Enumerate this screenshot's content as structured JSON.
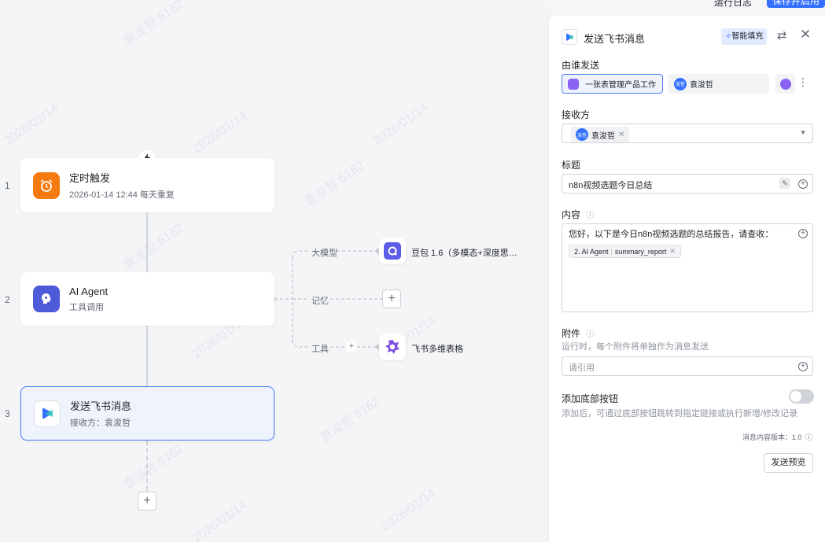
{
  "topbar": {
    "run_log": "运行日志",
    "save_publish": "保存并启用"
  },
  "watermark": {
    "text": "袁浚哲 6162",
    "date": "2026/01/14"
  },
  "flow": {
    "nodes": [
      {
        "num": "1",
        "title": "定时触发",
        "subtitle": "2026-01-14 12:44 每天重复"
      },
      {
        "num": "2",
        "title": "AI Agent",
        "subtitle": "工具调用"
      },
      {
        "num": "3",
        "title": "发送飞书消息",
        "subtitle": "接收方：袁浚哲"
      }
    ],
    "branches": [
      {
        "label": "大模型",
        "tool": "豆包 1.6（多模态+深度思…"
      },
      {
        "label": "记忆",
        "tool": ""
      },
      {
        "label": "工具",
        "tool": "飞书多维表格"
      }
    ]
  },
  "panel": {
    "title": "发送飞书消息",
    "smart_fill": "智能填充",
    "sender_label": "由谁发送",
    "sender_bot": "一张表管理产品工作",
    "sender_user": "袁浚哲",
    "receiver_label": "接收方",
    "receiver_chip": "袁浚哲",
    "avatar_text": "浚哲",
    "title_label": "标题",
    "title_value": "n8n视频选题今日总结",
    "content_label": "内容",
    "content_text": "您好，以下是今日n8n视频选题的总结报告，请查收：",
    "content_ref_step": "2. AI Agent",
    "content_ref_field": "summary_report",
    "attach_label": "附件",
    "attach_desc": "运行时，每个附件将单独作为消息发送",
    "attach_placeholder": "请引用",
    "bottom_btn_label": "添加底部按钮",
    "bottom_btn_desc": "添加后，可通过底部按钮跳转到指定链接或执行新增/修改记录",
    "version": "消息内容版本：1.0",
    "preview_button": "发送预览"
  },
  "colors": {
    "accent": "#3370ff",
    "trigger": "#f57a0f",
    "agent": "#4e5bd9",
    "selected_border": "#4e7cf6"
  }
}
